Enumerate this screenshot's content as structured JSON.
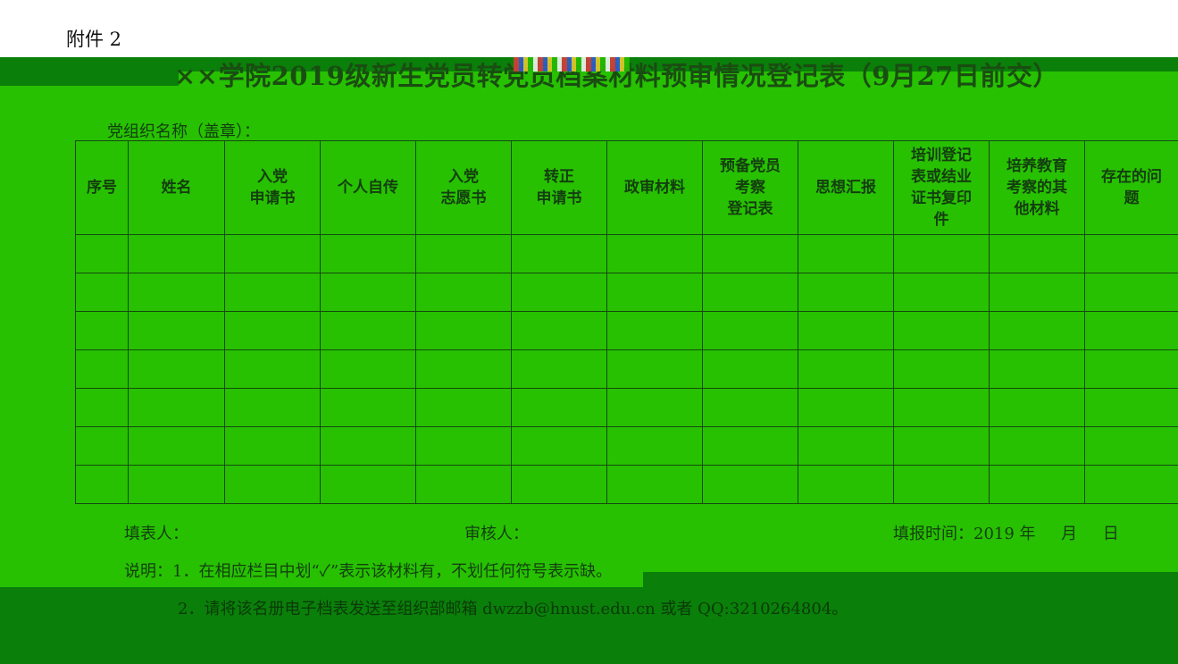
{
  "header": {
    "attachment_label": "附件 2",
    "title": "××学院2019级新生党员转党员档案材料预审情况登记表（9月27日前交）"
  },
  "form": {
    "org_label": "党组织名称（盖章）："
  },
  "table": {
    "columns": [
      "序号",
      "姓名",
      "入党\n申请书",
      "个人自传",
      "入党\n志愿书",
      "转正\n申请书",
      "政审材料",
      "预备党员\n考察\n登记表",
      "思想汇报",
      "培训登记\n表或结业\n证书复印\n件",
      "培养教育\n考察的其\n他材料",
      "存在的问\n题"
    ],
    "empty_rows": 7
  },
  "footer": {
    "filler": "填表人：",
    "reviewer": "审核人：",
    "date": "填报时间：2019 年     月     日"
  },
  "notes": {
    "line1": "说明：1．在相应栏目中划“✓”表示该材料有，不划任何符号表示缺。",
    "line2": "2．请将该名册电子档表发送至组织部邮箱 dwzzb@hnust.edu.cn 或者 QQ:3210264804。"
  },
  "colors": {
    "band_green": "#27c101",
    "band_dark": "#0a7f0a"
  }
}
